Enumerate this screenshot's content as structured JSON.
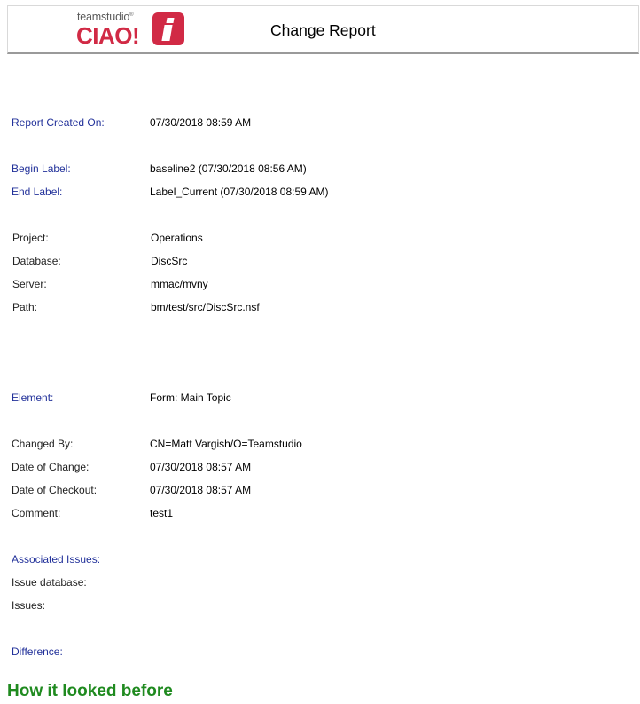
{
  "header": {
    "logo_top": "teamstudio",
    "logo_mark": "®",
    "logo_main": "CIAO!",
    "title": "Change Report"
  },
  "report": {
    "created_label": "Report Created On:",
    "created_value": "07/30/2018 08:59 AM",
    "begin_label": "Begin Label:",
    "begin_value": "baseline2 (07/30/2018 08:56 AM)",
    "end_label": "End Label:",
    "end_value": "Label_Current (07/30/2018 08:59 AM)"
  },
  "project": {
    "project_label": "Project:",
    "project_value": "Operations",
    "database_label": "Database:",
    "database_value": "DiscSrc",
    "server_label": "Server:",
    "server_value": "mmac/mvny",
    "path_label": "Path:",
    "path_value": "bm/test/src/DiscSrc.nsf"
  },
  "element": {
    "element_label": "Element:",
    "element_value": "Form: Main Topic",
    "changed_by_label": "Changed By:",
    "changed_by_value": "CN=Matt Vargish/O=Teamstudio",
    "date_change_label": "Date of Change:",
    "date_change_value": "07/30/2018 08:57 AM",
    "date_checkout_label": "Date of Checkout:",
    "date_checkout_value": "07/30/2018 08:57 AM",
    "comment_label": "Comment:",
    "comment_value": "test1",
    "assoc_issues_label": "Associated Issues:",
    "issue_db_label": "Issue database:",
    "issues_label": "Issues:",
    "difference_label": "Difference:"
  },
  "section": {
    "before_heading": "How it looked before"
  },
  "colors": {
    "brand_red": "#d12a45",
    "label_blue": "#22319a",
    "heading_green": "#1f8a1f"
  }
}
